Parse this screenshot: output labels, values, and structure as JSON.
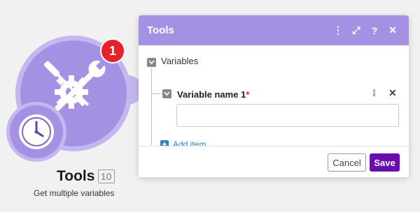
{
  "module": {
    "title": "Tools",
    "id": "10",
    "subtitle": "Get multiple variables",
    "notification_count": "1",
    "icon": "wrench-screwdriver-gear-icon",
    "badge_icon": "clock-icon",
    "color": "#a591e3"
  },
  "panel": {
    "title": "Tools",
    "header_icons": [
      "more-vertical-icon",
      "fullscreen-icon",
      "help-icon",
      "close-icon"
    ],
    "header_labels": [
      "⋮",
      "⤢",
      "?",
      "✕"
    ],
    "section_label": "Variables",
    "variable": {
      "label": "Variable name 1",
      "required_mark": "*",
      "value": ""
    },
    "add_item_label": "Add item",
    "cancel_label": "Cancel",
    "save_label": "Save"
  },
  "colors": {
    "accent": "#a591e3",
    "save": "#6a0dad",
    "link": "#2b82c9",
    "badge": "#e5212a"
  }
}
